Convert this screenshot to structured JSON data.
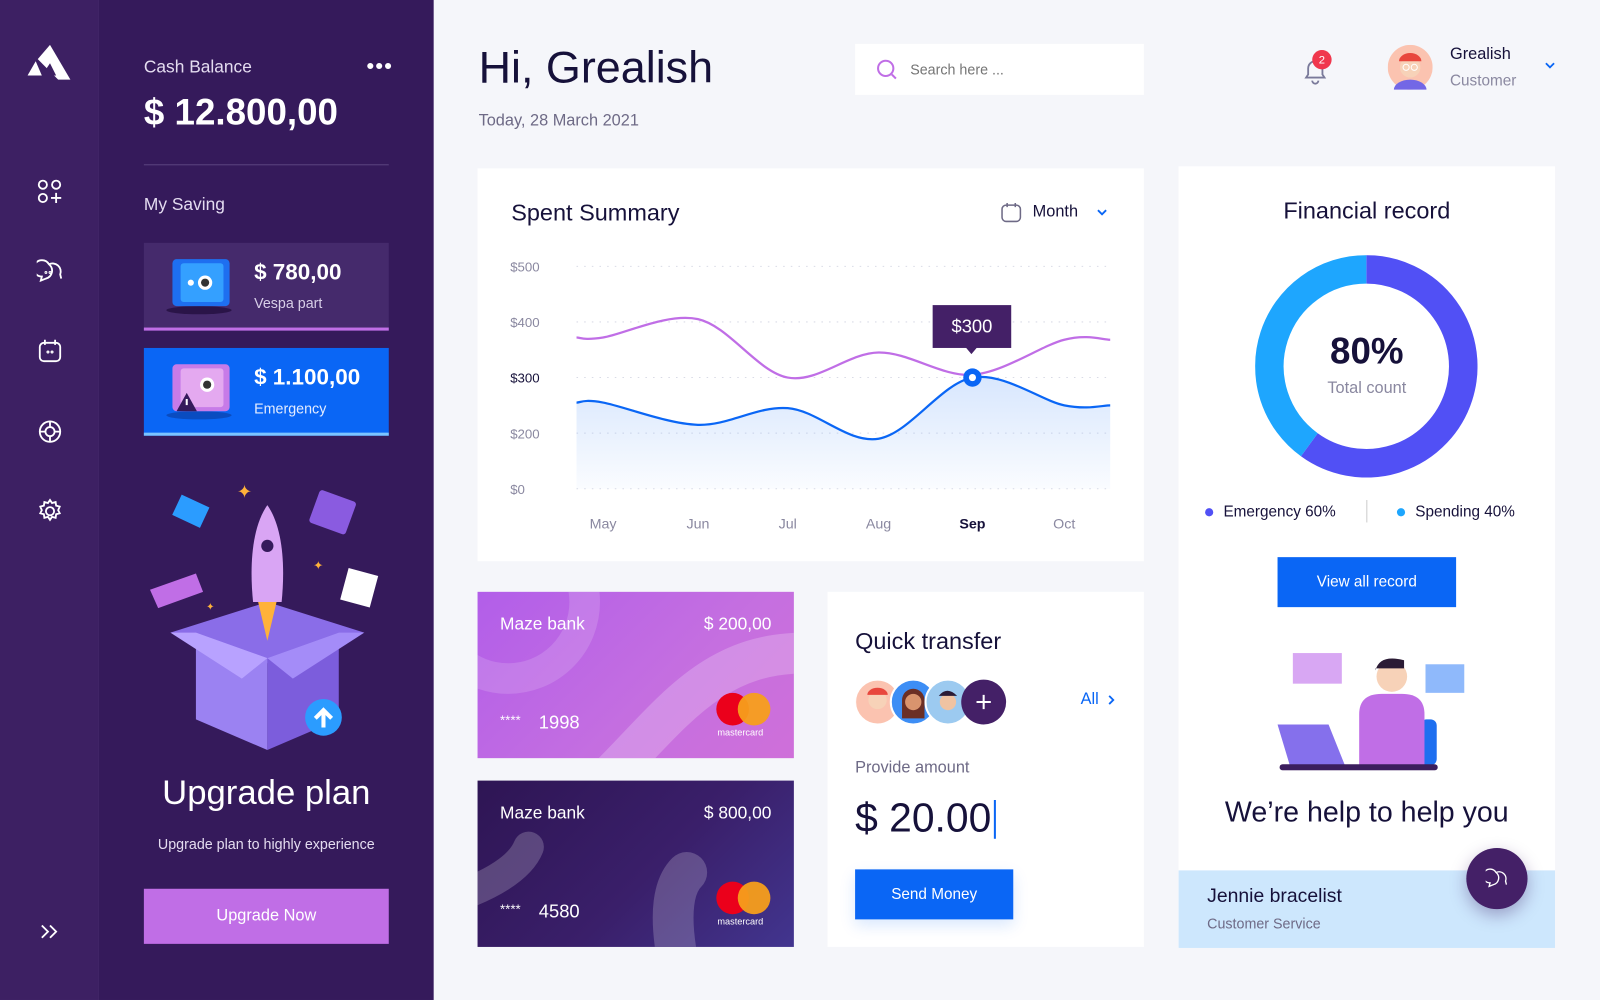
{
  "sidebar": {
    "icons": [
      "logo",
      "apps-icon",
      "chat-icon",
      "calendar-icon",
      "support-icon",
      "settings-icon",
      "expand-icon"
    ]
  },
  "panel": {
    "cash_label": "Cash Balance",
    "cash_value": "$ 12.800,00",
    "saving_label": "My Saving",
    "savings": [
      {
        "amount": "$ 780,00",
        "label": "Vespa part"
      },
      {
        "amount": "$ 1.100,00",
        "label": "Emergency"
      }
    ],
    "upgrade_title": "Upgrade plan",
    "upgrade_text": "Upgrade plan to highly experience",
    "upgrade_button": "Upgrade Now"
  },
  "header": {
    "greeting": "Hi, Grealish",
    "date": "Today, 28 March 2021",
    "search_placeholder": "Search here ...",
    "notification_count": "2",
    "user_name": "Grealish",
    "user_role": "Customer"
  },
  "spent": {
    "title": "Spent Summary",
    "period": "Month",
    "tooltip": "$300"
  },
  "chart_data": {
    "type": "area",
    "title": "Spent Summary",
    "categories": [
      "May",
      "Jun",
      "Jul",
      "Aug",
      "Sep",
      "Oct"
    ],
    "highlight_category": "Sep",
    "y_ticks": [
      "$0",
      "$200",
      "$300",
      "$400",
      "$500"
    ],
    "y_tick_values": [
      0,
      200,
      300,
      400,
      500
    ],
    "ylim": [
      0,
      500
    ],
    "grid": true,
    "series": [
      {
        "values": [
          372,
          405,
          300,
          345,
          305,
          368
        ],
        "color": "#c06ee6"
      },
      {
        "values": [
          255,
          215,
          245,
          180,
          300,
          250
        ],
        "color": "#0a66f5",
        "fill": true
      }
    ],
    "tooltip_value": "$300"
  },
  "financial": {
    "title": "Financial record",
    "center_value": "80%",
    "center_label": "Total count",
    "segments": [
      {
        "label": "Emergency 60%",
        "value": 60,
        "color": "#5150f5"
      },
      {
        "label": "Spending 40%",
        "value": 40,
        "color": "#1ea6fe"
      }
    ],
    "button": "View all record",
    "help_title": "We’re help to help you",
    "agent_name": "Jennie bracelist",
    "agent_role": "Customer Service"
  },
  "cards": [
    {
      "bank": "Maze bank",
      "balance": "$ 200,00",
      "mask": "****",
      "last4": "1998",
      "brand": "mastercard"
    },
    {
      "bank": "Maze bank",
      "balance": "$ 800,00",
      "mask": "****",
      "last4": "4580",
      "brand": "mastercard"
    }
  ],
  "transfer": {
    "title": "Quick transfer",
    "all_label": "All",
    "amount_label": "Provide amount",
    "amount": "$ 20.00",
    "button": "Send Money"
  },
  "colors": {
    "accent": "#0a66f5",
    "purple": "#c06ee6",
    "dark": "#351a5b"
  }
}
